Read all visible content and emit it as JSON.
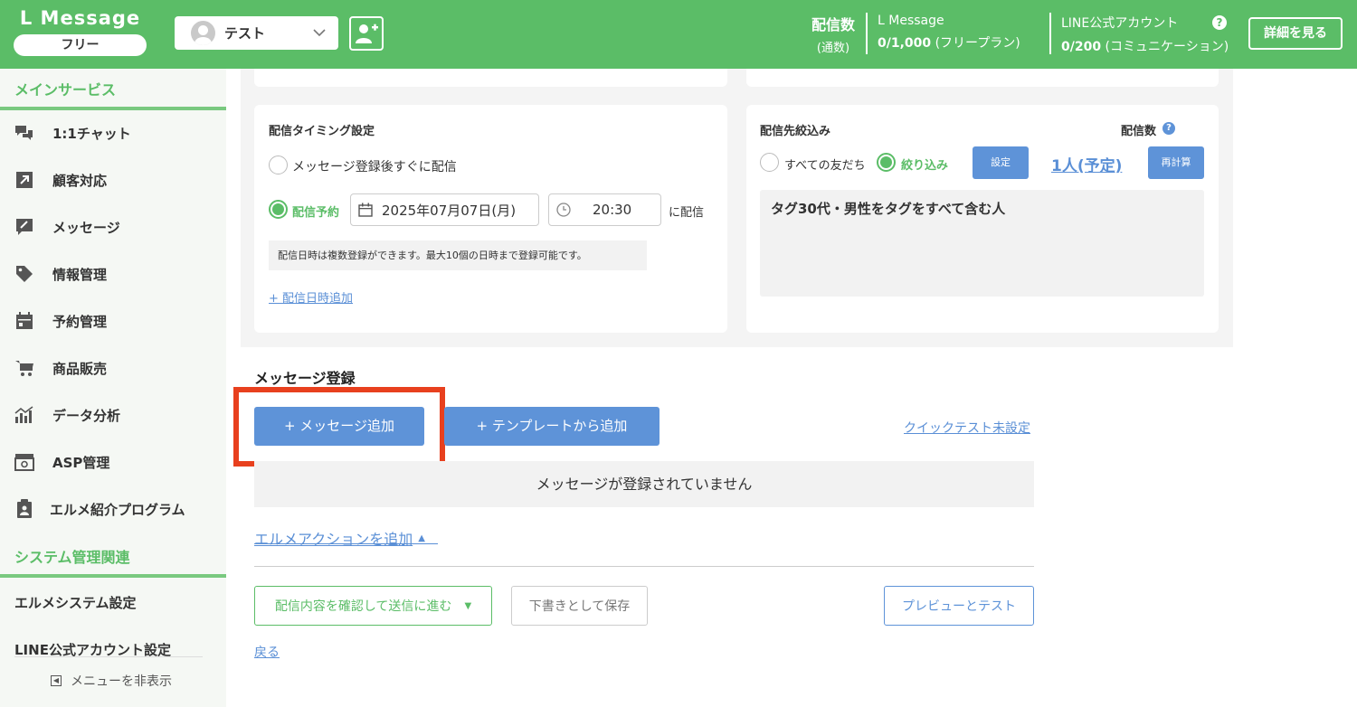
{
  "header": {
    "brand_title": "L Message",
    "brand_plan": "フリー",
    "account_name": "テスト",
    "stat_label_1": "配信数",
    "stat_label_2": "(通数)",
    "lmessage_label": "L Message",
    "lmessage_count": "0/1,000",
    "lmessage_plan": "(フリープラン)",
    "line_label": "LINE公式アカウント",
    "line_count": "0/200",
    "line_plan": "(コミュニケーション)",
    "detail_button": "詳細を見る"
  },
  "sidebar": {
    "section_main": "メインサービス",
    "items": [
      {
        "label": "1:1チャット",
        "icon": "chat-icon"
      },
      {
        "label": "顧客対応",
        "icon": "arrow-icon"
      },
      {
        "label": "メッセージ",
        "icon": "message-icon"
      },
      {
        "label": "情報管理",
        "icon": "tag-icon"
      },
      {
        "label": "予約管理",
        "icon": "calendar-icon"
      },
      {
        "label": "商品販売",
        "icon": "cart-icon"
      },
      {
        "label": "データ分析",
        "icon": "chart-icon"
      },
      {
        "label": "ASP管理",
        "icon": "box-icon"
      },
      {
        "label": "エルメ紹介プログラム",
        "icon": "clipboard-icon"
      }
    ],
    "section_system": "システム管理関連",
    "system_settings": "エルメシステム設定",
    "line_settings": "LINE公式アカウント設定",
    "hide_menu": "メニューを非表示"
  },
  "timing": {
    "title": "配信タイミング設定",
    "option_immediate": "メッセージ登録後すぐに配信",
    "option_scheduled": "配信予約",
    "date_value": "2025年07月07日(月)",
    "time_value": "20:30",
    "suffix": "に配信",
    "note": "配信日時は複数登録ができます。最大10個の日時まで登録可能です。",
    "add_datetime": "+ 配信日時追加"
  },
  "target": {
    "title": "配信先絞込み",
    "count_label": "配信数",
    "option_all": "すべての友だち",
    "option_filter": "絞り込み",
    "settings_button": "設定",
    "count_value": "1人(予定)",
    "recalc_button": "再計算",
    "filter_text": "タグ30代・男性をタグをすべて含む人"
  },
  "message_section": {
    "title": "メッセージ登録",
    "add_message": "+ メッセージ追加",
    "add_template": "+ テンプレートから追加",
    "quick_test": "クイックテスト未設定",
    "empty_text": "メッセージが登録されていません",
    "add_action": "エルメアクションを追加"
  },
  "footer": {
    "confirm_send": "配信内容を確認して送信に進む",
    "save_draft": "下書きとして保存",
    "preview_test": "プレビューとテスト",
    "back": "戻る"
  },
  "colors": {
    "brand_green": "#5bbd67",
    "accent_blue": "#5e93d8",
    "highlight_red": "#e8401e"
  }
}
